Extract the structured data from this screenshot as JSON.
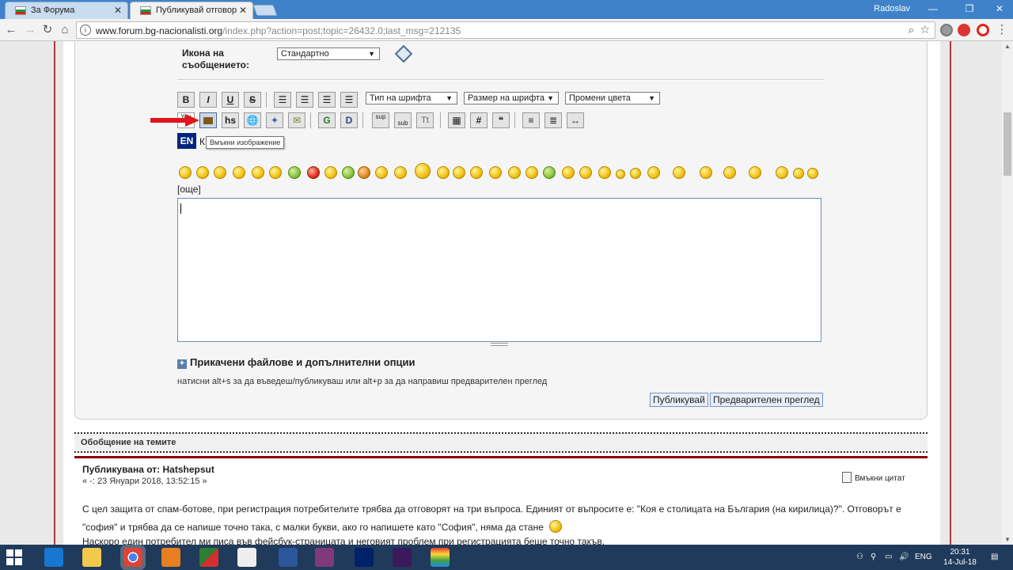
{
  "browser": {
    "tabs": [
      {
        "title": "За Форума",
        "active": false
      },
      {
        "title": "Публикувай отговор",
        "active": true
      }
    ],
    "user": "Radoslav",
    "window_controls": {
      "minimize": "—",
      "maximize": "❐",
      "close": "✕"
    },
    "url_host": "www.forum.bg-nacionalisti.org",
    "url_rest": "/index.php?action=post;topic=26432.0;last_msg=212135"
  },
  "form": {
    "icon_label_line1": "Икона на",
    "icon_label_line2": "съобщението:",
    "icon_select": "Стандартно",
    "font_select": "Тип на шрифта",
    "size_select": "Размер на шрифта",
    "color_select": "Промени цвета",
    "tooltip": "Вмъкни изображение",
    "lang_badge": "EN",
    "lang_letter": "К",
    "more_smileys": "[още]",
    "attachments_label": "Прикачени файлове и допълнителни опции",
    "shortcut_hint": "натисни alt+s за да въведеш/публикуваш или alt+p за да направиш предварителен преглед",
    "submit_button": "Публикувай",
    "preview_button": "Предварителен преглед"
  },
  "formatting_buttons": {
    "bold": "B",
    "italic": "I",
    "underline": "U",
    "strike": "S",
    "hs": "hs",
    "google": "G",
    "d": "D",
    "sup": "sup",
    "sub": "sub",
    "tt": "Tt",
    "hash": "#",
    "youtube": "You"
  },
  "summary": {
    "heading": "Обобщение на темите",
    "author": "Публикувана от: Hatshepsut",
    "date": "« -: 23 Януари 2018, 13:52:15 »",
    "quote_button": "Вмъкни цитат",
    "body_line1": "С цел защита от спам-ботове, при регистрация потребителите трябва да отговорят на три въпроса. Единият от въпросите е: \"Коя е столицата на България (на кирилица)?\". Отговорът е",
    "body_line2": "\"софия\" и трябва да се напише точно така, с малки букви, ако го напишете като \"София\", няма да стане",
    "body_line3": "Наскоро един потребител ми писа във фейсбук-страницата и неговият проблем при регистрацията беше точно такъв."
  },
  "taskbar": {
    "lang": "ENG",
    "time": "20:31",
    "date": "14-Jul-18"
  },
  "colors": {
    "accent_red": "#8b0000",
    "titlebar_blue": "#3f82c9",
    "taskbar": "#1f3a5a"
  }
}
